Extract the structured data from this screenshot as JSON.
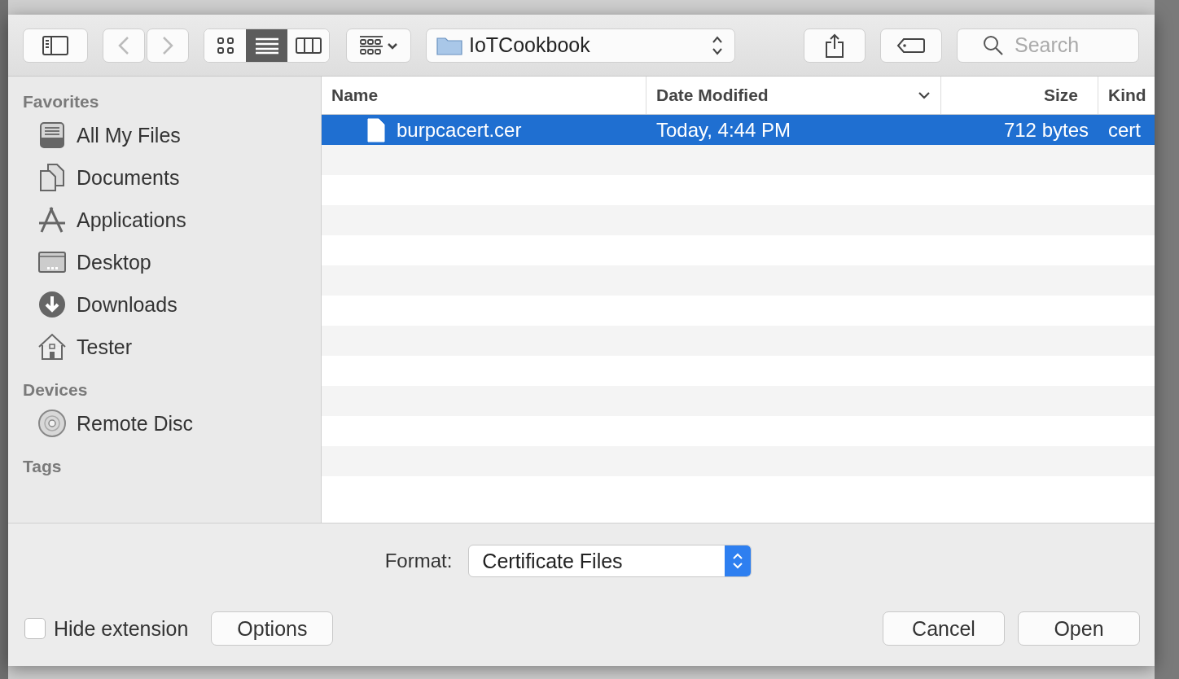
{
  "toolbar": {
    "views": [
      {
        "kind": "icons",
        "selected": false
      },
      {
        "kind": "list",
        "selected": true
      },
      {
        "kind": "columns",
        "selected": false
      }
    ],
    "location": "IoTCookbook",
    "search": {
      "placeholder": "Search"
    }
  },
  "sidebar": {
    "sections": [
      {
        "title": "Favorites",
        "items": [
          {
            "label": "All My Files",
            "kind": "files"
          },
          {
            "label": "Documents",
            "kind": "documents"
          },
          {
            "label": "Applications",
            "kind": "applications"
          },
          {
            "label": "Desktop",
            "kind": "desktop"
          },
          {
            "label": "Downloads",
            "kind": "downloads"
          },
          {
            "label": "Tester",
            "kind": "home"
          }
        ]
      },
      {
        "title": "Devices",
        "items": [
          {
            "label": "Remote Disc",
            "kind": "disc"
          }
        ]
      },
      {
        "title": "Tags"
      }
    ]
  },
  "table": {
    "columns": [
      "Name",
      "Date Modified",
      "Size",
      "Kind"
    ],
    "rows": [
      {
        "cells": [
          "burpcacert.cer",
          "Today, 4:44 PM",
          "712 bytes",
          "cert"
        ],
        "selected": true
      }
    ]
  },
  "format": {
    "label": "Format:",
    "value": "Certificate Files"
  },
  "hide_extension": {
    "label": "Hide extension",
    "checked": false
  },
  "buttons": [
    "Options",
    "Cancel",
    "Open"
  ]
}
